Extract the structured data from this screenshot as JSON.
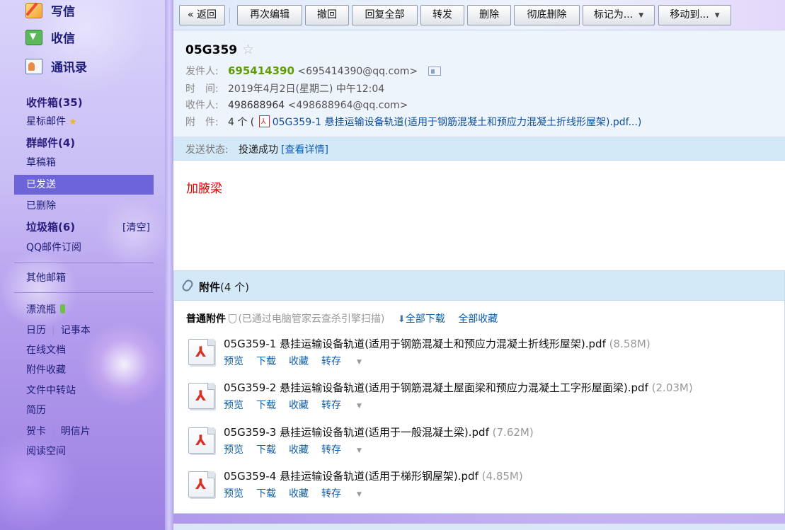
{
  "sidebar": {
    "compose": "写信",
    "receive": "收信",
    "contacts": "通讯录",
    "folders": {
      "inbox": "收件箱(35)",
      "starred": "星标邮件",
      "group": "群邮件(4)",
      "drafts": "草稿箱",
      "sent": "已发送",
      "deleted": "已删除",
      "spam": "垃圾箱(6)",
      "spam_clear": "[清空]",
      "subscriptions": "QQ邮件订阅",
      "other": "其他邮箱"
    },
    "apps": {
      "bottle": "漂流瓶",
      "calendar": "日历",
      "notes": "记事本",
      "docs": "在线文档",
      "attach_fav": "附件收藏",
      "transfer": "文件中转站",
      "resume": "简历",
      "card": "贺卡",
      "postcard": "明信片",
      "reading": "阅读空间"
    }
  },
  "toolbar": {
    "back": "« 返回",
    "reedit": "再次编辑",
    "recall": "撤回",
    "reply_all": "回复全部",
    "forward": "转发",
    "delete": "删除",
    "delete_perm": "彻底删除",
    "mark_as": "标记为...",
    "move_to": "移动到..."
  },
  "mail": {
    "subject": "05G359",
    "from_label": "发件人:",
    "from_name": "695414390",
    "from_addr": "<695414390@qq.com>",
    "time_label": "时　间:",
    "time_value": "2019年4月2日(星期二) 中午12:04",
    "to_label": "收件人:",
    "to_name": "498688964",
    "to_addr": "<498688964@qq.com>",
    "attach_label": "附　件:",
    "attach_count": "4 个 (",
    "attach_first": "05G359-1 悬挂运输设备轨道(适用于钢筋混凝土和预应力混凝土折线形屋架).pdf...)",
    "status_label": "发送状态:",
    "status_value": "投递成功",
    "status_link": "[查看详情]",
    "body": "加腋梁"
  },
  "attachments": {
    "title": "附件",
    "count": "(4 个)",
    "normal_label": "普通附件",
    "scan_text": "(已通过电脑管家云查杀引擎扫描)",
    "download_all": "全部下载",
    "collect_all": "全部收藏",
    "files": [
      {
        "name": "05G359-1 悬挂运输设备轨道(适用于钢筋混凝土和预应力混凝土折线形屋架).pdf",
        "size": "(8.58M)"
      },
      {
        "name": "05G359-2 悬挂运输设备轨道(适用于钢筋混凝土屋面梁和预应力混凝土工字形屋面梁).pdf",
        "size": "(2.03M)"
      },
      {
        "name": "05G359-3 悬挂运输设备轨道(适用于一般混凝土梁).pdf",
        "size": "(7.62M)"
      },
      {
        "name": "05G359-4 悬挂运输设备轨道(适用于梯形钢屋架).pdf",
        "size": "(4.85M)"
      }
    ],
    "actions": {
      "preview": "预览",
      "download": "下载",
      "collect": "收藏",
      "save_to": "转存"
    }
  }
}
